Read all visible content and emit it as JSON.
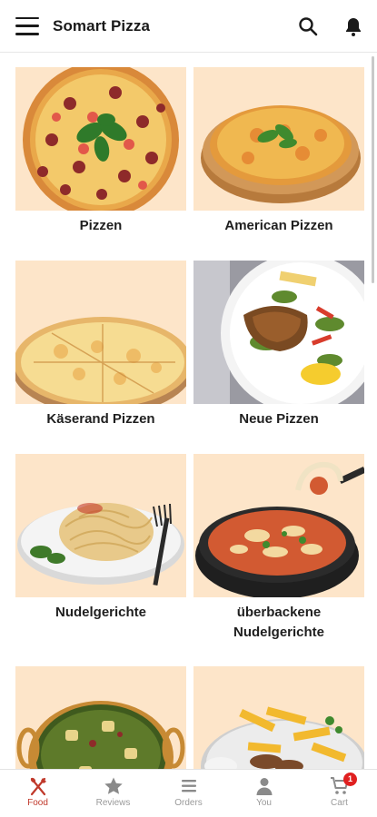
{
  "header": {
    "title": "Somart Pizza",
    "menu_icon": "hamburger-menu-icon",
    "search_icon": "search-icon",
    "notification_icon": "bell-icon"
  },
  "categories": [
    {
      "label": "Pizzen"
    },
    {
      "label": "American Pizzen"
    },
    {
      "label": "Käserand Pizzen"
    },
    {
      "label": "Neue Pizzen"
    },
    {
      "label": "Nudelgerichte"
    },
    {
      "label": "überbackene Nudelgerichte"
    },
    {
      "label": ""
    },
    {
      "label": ""
    }
  ],
  "bottom_nav": {
    "items": [
      {
        "label": "Food",
        "icon": "fork-knife-icon",
        "active": true
      },
      {
        "label": "Reviews",
        "icon": "star-icon",
        "active": false
      },
      {
        "label": "Orders",
        "icon": "list-icon",
        "active": false
      },
      {
        "label": "You",
        "icon": "person-icon",
        "active": false
      },
      {
        "label": "Cart",
        "icon": "cart-icon",
        "active": false
      }
    ],
    "cart_badge": "1"
  },
  "colors": {
    "accent": "#c0392b",
    "card_background": "#fde5c9",
    "badge": "#e02020"
  }
}
